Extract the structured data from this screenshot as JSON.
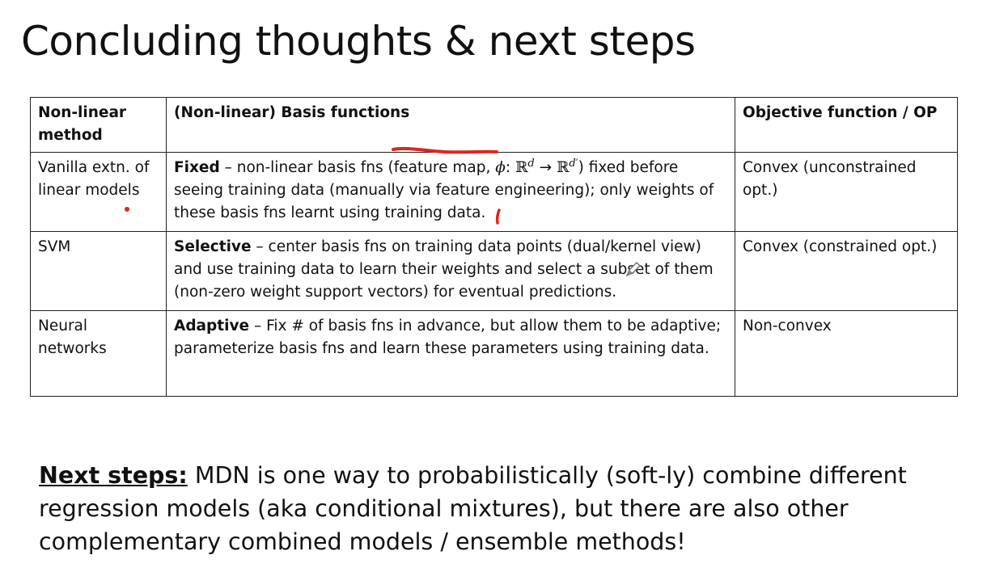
{
  "slide": {
    "title": "Concluding thoughts & next steps"
  },
  "table": {
    "headers": [
      "Non-linear method",
      "(Non-linear) Basis functions",
      "Objective function / OP"
    ],
    "rows": [
      {
        "method": "Vanilla extn. of linear models",
        "basis_lead": "Fixed",
        "basis_pre": " – non-linear basis fns (feature map, ",
        "basis_math_phi": "ϕ",
        "basis_math_colon": ": ",
        "basis_math_R1": "ℝ",
        "basis_math_d1": "d",
        "basis_math_arrow": " → ",
        "basis_math_R2": "ℝ",
        "basis_math_d2": "d′",
        "basis_post": ") fixed before seeing training data (manually via feature engineering); only weights of these basis fns learnt using training data.",
        "objective": "Convex (unconstrained opt.)"
      },
      {
        "method": "SVM",
        "basis_lead": "Selective",
        "basis_rest": " – center basis fns on training data points (dual/kernel view) and use training data to learn their weights and select a subset of them (non-zero weight support vectors) for eventual predictions.",
        "objective": "Convex (constrained opt.)"
      },
      {
        "method": "Neural networks",
        "basis_lead": "Adaptive",
        "basis_rest": " – Fix # of basis fns in advance, but allow them to be adaptive; parameterize basis fns and learn these parameters using training data.",
        "objective": "Non-convex"
      }
    ]
  },
  "next_steps": {
    "label": "Next steps:",
    "text": " MDN is one way to probabilistically (soft-ly) combine different regression models (aka conditional mixtures), but there are also other complementary combined models / ensemble methods!"
  },
  "annotation": {
    "ink_color": "#e0251b"
  }
}
